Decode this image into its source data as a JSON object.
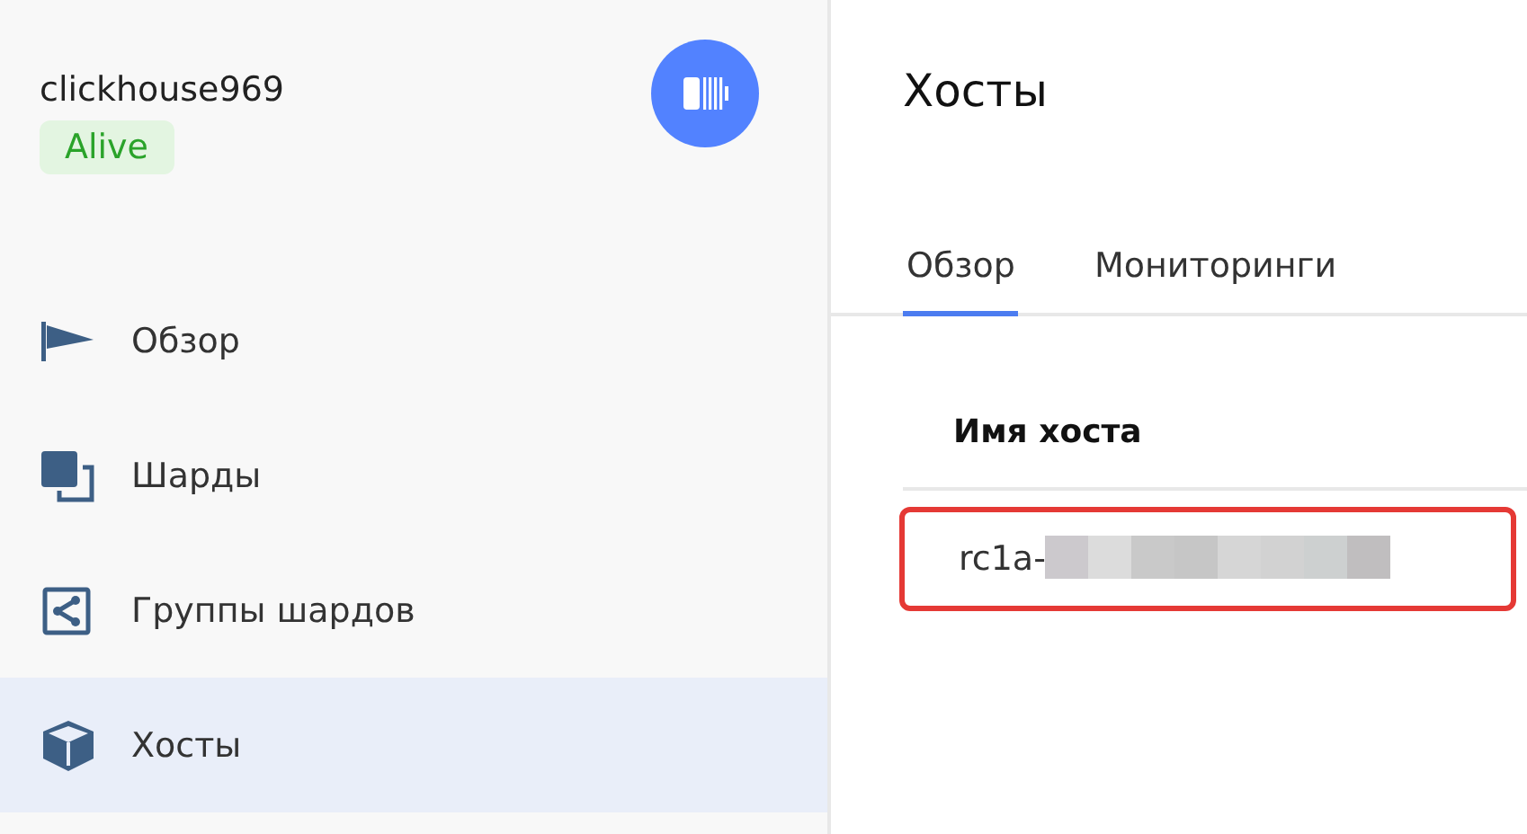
{
  "cluster": {
    "name": "clickhouse969",
    "status": "Alive"
  },
  "nav": [
    {
      "label": "Обзор",
      "kind": "flag",
      "selected": false
    },
    {
      "label": "Шарды",
      "kind": "shards",
      "selected": false
    },
    {
      "label": "Группы шардов",
      "kind": "share",
      "selected": false
    },
    {
      "label": "Хосты",
      "kind": "cube",
      "selected": true
    }
  ],
  "page": {
    "title": "Хосты"
  },
  "tabs": [
    {
      "label": "Обзор",
      "selected": true
    },
    {
      "label": "Мониторинги",
      "selected": false
    }
  ],
  "table": {
    "columns": [
      "Имя хоста"
    ],
    "rows": [
      {
        "host": "rc1a-",
        "redacted": true,
        "highlighted": true
      }
    ]
  }
}
